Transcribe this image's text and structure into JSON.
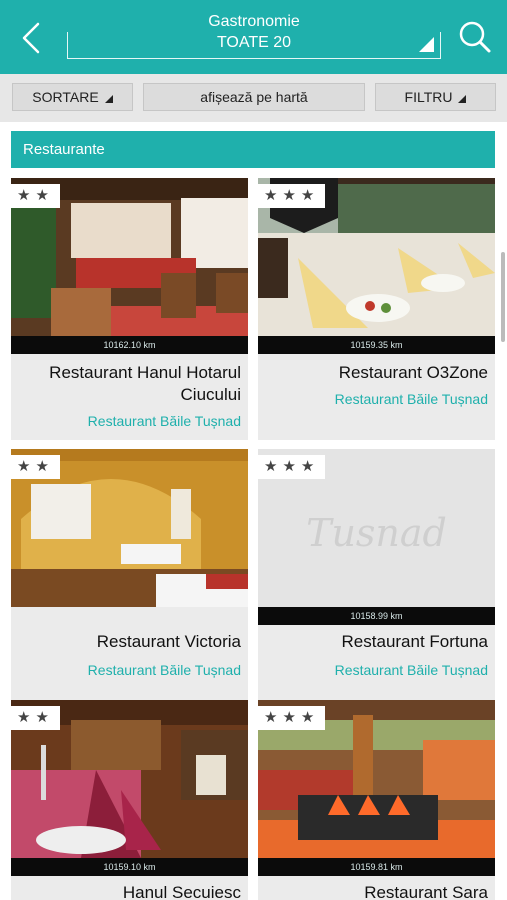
{
  "header": {
    "title": "Gastronomie",
    "category_value": "TOATE 20",
    "icons": {
      "back": "chevron-left-icon",
      "search": "search-icon",
      "dropdown": "caret-down-icon"
    },
    "colors": {
      "accent": "#1fb0ac"
    }
  },
  "toolbar": {
    "sort_label": "SORTARE",
    "map_label": "afișează pe hartă",
    "filter_label": "FILTRU"
  },
  "section": {
    "title": "Restaurante"
  },
  "cards": [
    {
      "name": "Restaurant Hanul Hotarul Ciucului",
      "location": "Restaurant Băile Tușnad",
      "distance": "10162.10 km",
      "stars": "★★",
      "stars_count": 2
    },
    {
      "name": "Restaurant O3Zone",
      "location": "Restaurant Băile Tușnad",
      "distance": "10159.35 km",
      "stars": "★★★",
      "stars_count": 3
    },
    {
      "name": "Restaurant Victoria",
      "location": "Restaurant Băile Tușnad",
      "distance": "",
      "stars": "★★",
      "stars_count": 2
    },
    {
      "name": "Restaurant Fortuna",
      "location": "Restaurant Băile Tușnad",
      "distance": "10158.99 km",
      "stars": "★★★",
      "stars_count": 3,
      "placeholder_text": "Tusnad"
    },
    {
      "name": "Hanul Secuiesc",
      "location": "",
      "distance": "10159.10 km",
      "stars": "★★",
      "stars_count": 2
    },
    {
      "name": "Restaurant Sara",
      "location": "",
      "distance": "10159.81 km",
      "stars": "★★★",
      "stars_count": 3
    }
  ]
}
